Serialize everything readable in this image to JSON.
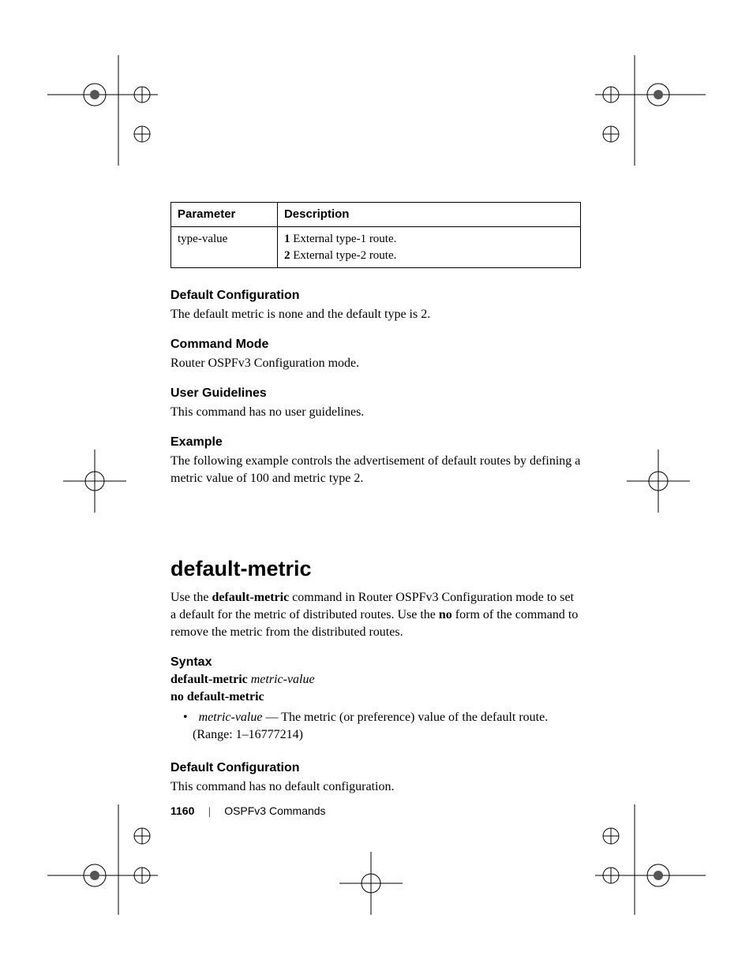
{
  "table": {
    "header_param": "Parameter",
    "header_desc": "Description",
    "row_param": "type-value",
    "row_desc_b1": "1",
    "row_desc_t1": " External type-1 route.",
    "row_desc_b2": "2",
    "row_desc_t2": " External type-2 route."
  },
  "sec1": {
    "h": "Default Configuration",
    "p": "The default metric is none and the default type is 2."
  },
  "sec2": {
    "h": "Command Mode",
    "p": "Router OSPFv3 Configuration mode."
  },
  "sec3": {
    "h": "User Guidelines",
    "p": "This command has no user guidelines."
  },
  "sec4": {
    "h": "Example",
    "p": "The following example controls the advertisement of default routes by defining a metric value of 100 and metric type 2."
  },
  "cmd": {
    "title": "default-metric",
    "intro_a": "Use the ",
    "intro_b": "default-metric",
    "intro_c": " command in Router OSPFv3 Configuration mode to set a default for the metric of distributed routes. Use the ",
    "intro_d": "no",
    "intro_e": " form of the command to remove the metric from the distributed routes."
  },
  "syntax": {
    "h": "Syntax",
    "l1_b": "default-metric ",
    "l1_i": "metric-value",
    "l2": "no default-metric",
    "bullet_i": "metric-value",
    "bullet_t": " — The metric (or preference) value of the default route. (Range: 1–16777214)"
  },
  "dc2": {
    "h": "Default Configuration",
    "p": "This command has no default configuration."
  },
  "footer": {
    "page": "1160",
    "chapter": "OSPFv3 Commands"
  }
}
